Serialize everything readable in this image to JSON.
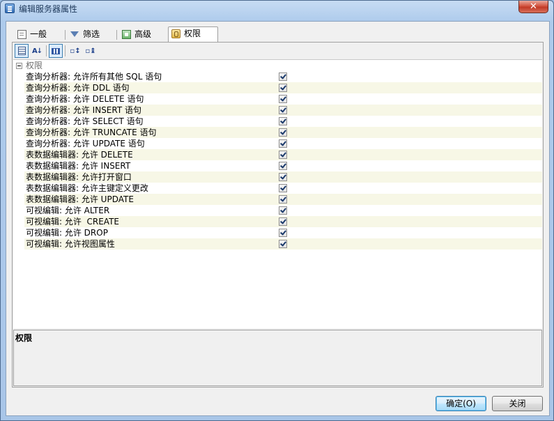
{
  "window": {
    "title": "编辑服务器属性",
    "close_label": "✕"
  },
  "tabs": [
    {
      "label": "一般",
      "icon": "document-icon",
      "active": false
    },
    {
      "label": "筛选",
      "icon": "filter-icon",
      "active": false
    },
    {
      "label": "高级",
      "icon": "advanced-icon",
      "active": false
    },
    {
      "label": "权限",
      "icon": "permission-icon",
      "active": true
    }
  ],
  "toolbar": {
    "categorized": "categorized-view-icon",
    "alphabetical": "alphabetical-sort-icon",
    "property_pages": "property-pages-icon",
    "expand_all": "expand-all-icon",
    "collapse_all": "collapse-all-icon"
  },
  "grid": {
    "category": "权限",
    "rows": [
      {
        "label": "查询分析器: 允许所有其他 SQL 语句",
        "checked": true
      },
      {
        "label": "查询分析器: 允许 DDL 语句",
        "checked": true
      },
      {
        "label": "查询分析器: 允许 DELETE 语句",
        "checked": true
      },
      {
        "label": "查询分析器: 允许 INSERT 语句",
        "checked": true
      },
      {
        "label": "查询分析器: 允许 SELECT 语句",
        "checked": true
      },
      {
        "label": "查询分析器: 允许 TRUNCATE 语句",
        "checked": true
      },
      {
        "label": "查询分析器: 允许 UPDATE 语句",
        "checked": true
      },
      {
        "label": "表数据编辑器: 允许 DELETE",
        "checked": true
      },
      {
        "label": "表数据编辑器: 允许 INSERT",
        "checked": true
      },
      {
        "label": "表数据编辑器: 允许打开窗口",
        "checked": true
      },
      {
        "label": "表数据编辑器: 允许主键定义更改",
        "checked": true
      },
      {
        "label": "表数据编辑器: 允许 UPDATE",
        "checked": true
      },
      {
        "label": "可视编辑: 允许 ALTER",
        "checked": true
      },
      {
        "label": "可视编辑: 允许  CREATE",
        "checked": true
      },
      {
        "label": "可视编辑: 允许 DROP",
        "checked": true
      },
      {
        "label": "可视编辑: 允许视图属性",
        "checked": true
      }
    ]
  },
  "description": {
    "title": "权限"
  },
  "buttons": {
    "ok": "确定(O)",
    "close": "关闭"
  }
}
